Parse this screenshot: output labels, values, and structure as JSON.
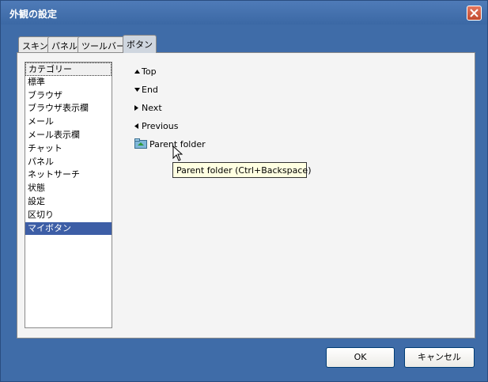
{
  "window": {
    "title": "外観の設定"
  },
  "tabs": [
    {
      "label": "スキン",
      "active": false
    },
    {
      "label": "パネル",
      "active": false
    },
    {
      "label": "ツールバー",
      "active": false
    },
    {
      "label": "ボタン",
      "active": true
    }
  ],
  "category_list": {
    "items": [
      "カテゴリー",
      "標準",
      "ブラウザ",
      "ブラウザ表示欄",
      "メール",
      "メール表示欄",
      "チャット",
      "パネル",
      "ネットサーチ",
      "状態",
      "設定",
      "区切り",
      "マイボタン"
    ],
    "focused": "カテゴリー",
    "selected": "マイボタン"
  },
  "buttons": [
    {
      "label": "Top",
      "icon": "triangle-up-icon"
    },
    {
      "label": "End",
      "icon": "triangle-down-icon"
    },
    {
      "label": "Next",
      "icon": "triangle-right-icon"
    },
    {
      "label": "Previous",
      "icon": "triangle-left-icon"
    },
    {
      "label": "Parent folder",
      "icon": "parent-folder-icon"
    }
  ],
  "tooltip": {
    "text": "Parent folder (Ctrl+Backspace)"
  },
  "dialog_buttons": {
    "ok": "OK",
    "cancel": "キャンセル"
  },
  "colors": {
    "title_bar": "#3f6ca8",
    "selection": "#3d5ea6",
    "tooltip_bg": "#ffffe1",
    "close_button": "#c24a2e"
  }
}
